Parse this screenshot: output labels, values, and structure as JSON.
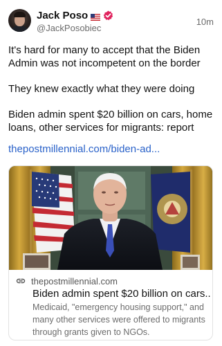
{
  "post": {
    "author": {
      "display_name": "Jack Poso",
      "handle": "@JackPosobiec",
      "flag_icon": "us-flag-icon",
      "verified_icon": "verified-badge-icon",
      "verified_color": "#e0245e"
    },
    "time": "10m",
    "paragraphs": [
      "It's hard for many to accept that the Biden Admin was not incompetent on the border",
      "They knew exactly what they were doing",
      "Biden admin spent $20 billion on cars, home loans, other services for migrants: report"
    ],
    "link": "thepostmillennial.com/biden-ad...",
    "link_color": "#2a62c9"
  },
  "card": {
    "domain": "thepostmillennial.com",
    "link_icon": "link-icon",
    "title": "Biden admin spent $20 billion on cars...",
    "description": "Medicaid, \"emergency housing support,\" and many other services were offered to migrants through grants given to NGOs."
  }
}
